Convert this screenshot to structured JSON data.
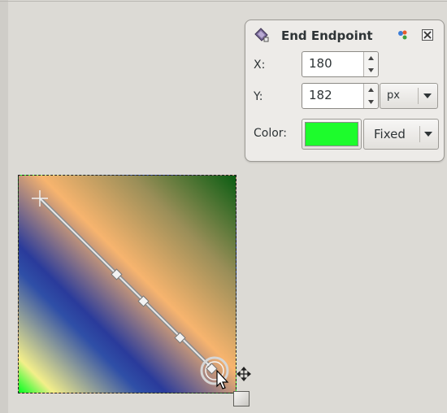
{
  "dialog": {
    "title": "End Endpoint",
    "x_label": "X:",
    "x_value": "180",
    "y_label": "Y:",
    "y_value": "182",
    "unit": "px",
    "color_label": "Color:",
    "color_value": "#1dfc2c",
    "color_mode": "Fixed"
  },
  "icons": {
    "dialog_icon": "blend-tool-icon",
    "palette_icon": "color-palette-icon",
    "close_icon": "close-icon",
    "crosshair_icon": "start-crosshair-icon",
    "cursor_icon": "mouse-pointer-icon",
    "move_icon": "move-arrows-icon",
    "resize_icon": "resize-handle-icon"
  },
  "canvas": {
    "gradient_colors": [
      "#00ff1e",
      "#f3ef8a",
      "#2f4fa7",
      "#f7b46e",
      "#9a8e58",
      "#0b5d12"
    ]
  }
}
